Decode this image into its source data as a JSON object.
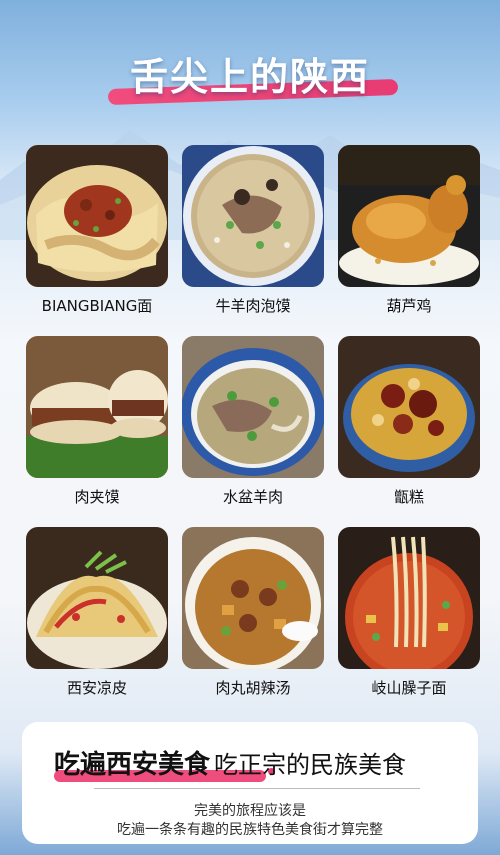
{
  "page": {
    "title": "舌尖上的陕西"
  },
  "foods": [
    {
      "name": "BIANGBIANG面",
      "image_icon": "biangbiang-noodles-photo"
    },
    {
      "name": "牛羊肉泡馍",
      "image_icon": "paomo-soup-photo"
    },
    {
      "name": "葫芦鸡",
      "image_icon": "hulu-chicken-photo"
    },
    {
      "name": "肉夹馍",
      "image_icon": "roujiamo-photo"
    },
    {
      "name": "水盆羊肉",
      "image_icon": "mutton-soup-photo"
    },
    {
      "name": "甑糕",
      "image_icon": "zenggao-photo"
    },
    {
      "name": "西安凉皮",
      "image_icon": "liangpi-photo"
    },
    {
      "name": "肉丸胡辣汤",
      "image_icon": "hulatang-photo"
    },
    {
      "name": "岐山臊子面",
      "image_icon": "saozi-noodles-photo"
    }
  ],
  "footer": {
    "headline": "吃遍西安美食",
    "headline_sub": "吃正宗的民族美食",
    "line1": "完美的旅程应该是",
    "line2": "吃遍一条条有趣的民族特色美食街才算完整"
  },
  "colors": {
    "accent": "#ef4d7e",
    "sky": "#7fb0dd"
  }
}
